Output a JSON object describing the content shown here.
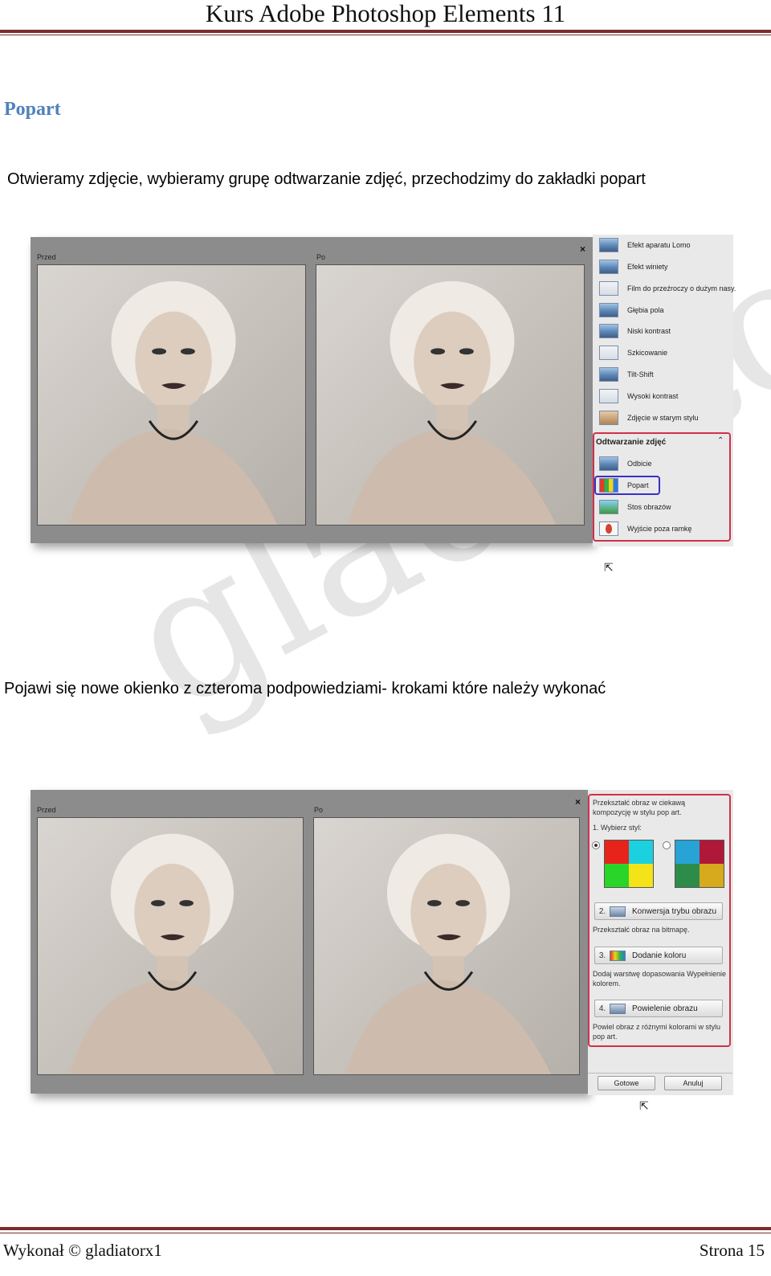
{
  "header": {
    "title": "Kurs Adobe Photoshop Elements 11"
  },
  "section": {
    "heading": "Popart",
    "intro": "Otwieramy zdjęcie, wybieramy grupę odtwarzanie zdjęć, przechodzimy do zakładki popart",
    "second": "Pojawi się nowe okienko z czteroma podpowiedziami- krokami które należy wykonać"
  },
  "watermark": "gladiator",
  "shot1": {
    "before_label": "Przed",
    "after_label": "Po",
    "close": "×",
    "effects": [
      {
        "label": "Efekt aparatu Lomo",
        "icon": "photo-thumb-icon"
      },
      {
        "label": "Efekt winiety",
        "icon": "photo-thumb-icon"
      },
      {
        "label": "Film do przeźroczy o dużym nasy.",
        "icon": "photo-thumb-icon"
      },
      {
        "label": "Głębia pola",
        "icon": "photo-thumb-icon"
      },
      {
        "label": "Niski kontrast",
        "icon": "photo-thumb-icon"
      },
      {
        "label": "Szkicowanie",
        "icon": "photo-thumb-icon"
      },
      {
        "label": "Tilt-Shift",
        "icon": "photo-thumb-icon"
      },
      {
        "label": "Wysoki kontrast",
        "icon": "photo-thumb-icon"
      },
      {
        "label": "Zdjęcie w starym stylu",
        "icon": "photo-thumb-icon"
      }
    ],
    "group_title": "Odtwarzanie zdjęć",
    "group_items": [
      {
        "label": "Odbicie",
        "icon": "reflection-icon"
      },
      {
        "label": "Popart",
        "icon": "popart-icon"
      },
      {
        "label": "Stos obrazów",
        "icon": "image-stack-icon"
      },
      {
        "label": "Wyjście poza ramkę",
        "icon": "out-of-bounds-icon"
      }
    ]
  },
  "shot2": {
    "before_label": "Przed",
    "after_label": "Po",
    "close": "×",
    "description": "Przekształć obraz w ciekawą kompozycję w stylu pop art.",
    "step1_label": "1. Wybierz styl:",
    "steps": [
      {
        "num": "2.",
        "label": "Konwersja trybu obrazu",
        "note": "Przekształć obraz na bitmapę."
      },
      {
        "num": "3.",
        "label": "Dodanie koloru",
        "note": "Dodaj warstwę dopasowania Wypełnienie kolorem."
      },
      {
        "num": "4.",
        "label": "Powielenie obrazu",
        "note": "Powiel obraz z różnymi kolorami w stylu pop art."
      }
    ],
    "done_button": "Gotowe",
    "cancel_button": "Anuluj",
    "style1_colors": [
      "#e8231c",
      "#1bd1e0",
      "#2ad52a",
      "#f5e31a"
    ],
    "style2_colors": [
      "#27a3d6",
      "#b0183a",
      "#2e8c4a",
      "#d7a91c"
    ]
  },
  "footer": {
    "left": "Wykonał © gladiatorx1",
    "right": "Strona 15"
  }
}
